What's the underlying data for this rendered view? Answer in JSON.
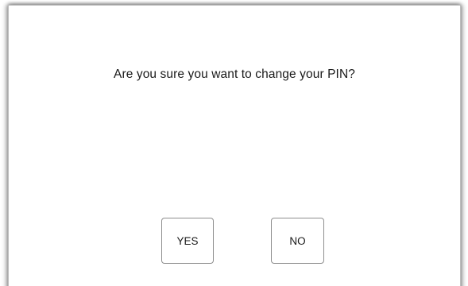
{
  "dialog": {
    "message": "Are you sure you want to change your PIN?",
    "yes_label": "YES",
    "no_label": "NO"
  }
}
